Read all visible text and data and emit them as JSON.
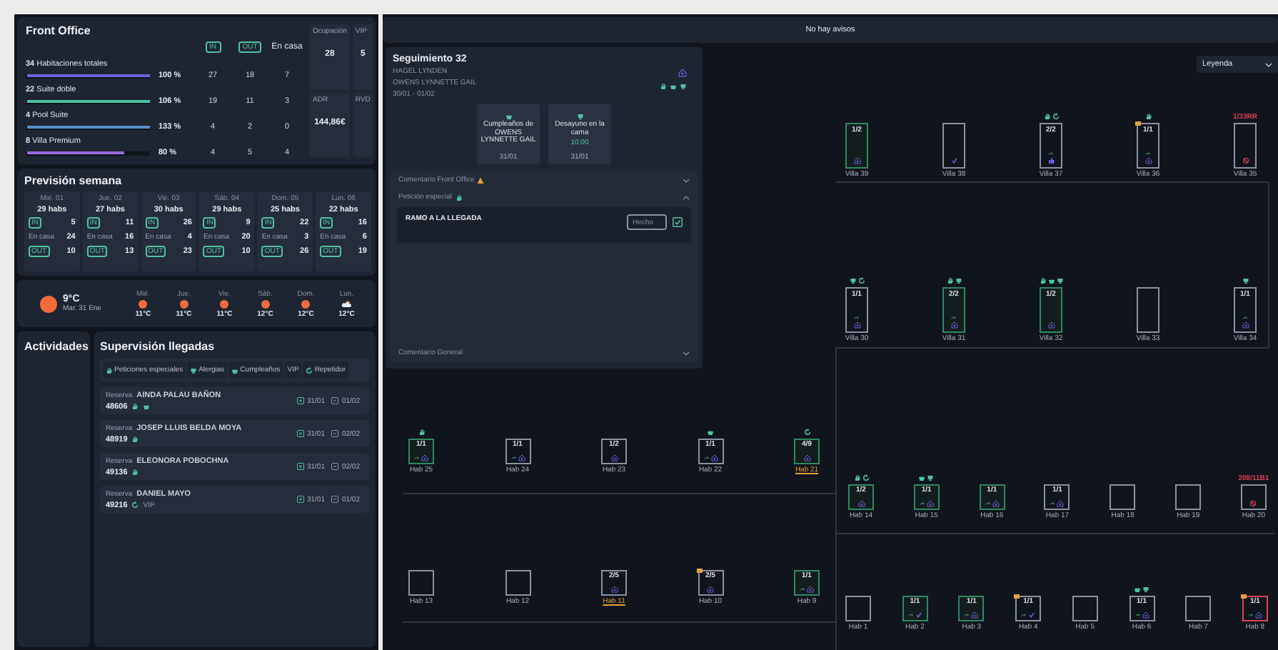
{
  "front_office": {
    "title": "Front Office",
    "columns": [
      {
        "text": "IN",
        "kind": "badge"
      },
      {
        "text": "OUT",
        "kind": "badge"
      },
      {
        "text": "En casa",
        "kind": "plain"
      }
    ],
    "rows": [
      {
        "label": "**34** Habitaciones totales",
        "level": 1,
        "color": "#6c63e0",
        "percent": "100 %",
        "values": [
          "27",
          "18",
          "7"
        ]
      },
      {
        "label": "**22** Suite doble",
        "level": 1,
        "color": "#4fc3a1",
        "percent": "106 %",
        "values": [
          "19",
          "11",
          "3"
        ]
      },
      {
        "label": "**4** Pool Suite",
        "level": 1,
        "color": "#5b8fc9",
        "percent": "133 %",
        "values": [
          "4",
          "2",
          "0"
        ]
      },
      {
        "label": "**8** Villa Premium",
        "level": 0.8,
        "color": "#9b6be0",
        "percent": "80 %",
        "values": [
          "4",
          "5",
          "4"
        ]
      }
    ],
    "stats": [
      {
        "label": "Ocupación",
        "value": "28"
      },
      {
        "label": "VIP",
        "value": "5"
      },
      {
        "label": "ADR",
        "value": "144,86€"
      },
      {
        "label": "RVD"
      }
    ]
  },
  "forecast": {
    "title": "Previsión semana",
    "days": [
      {
        "day": "Mié. 01",
        "rooms": "29 habs",
        "rows": [
          {
            "label": "IN",
            "kind": "badge",
            "value": "5"
          },
          {
            "label": "En casa",
            "kind": "plain",
            "value": "24"
          },
          {
            "label": "OUT",
            "kind": "badge",
            "value": "10"
          }
        ]
      },
      {
        "day": "Jue. 02",
        "rooms": "27 habs",
        "rows": [
          {
            "label": "IN",
            "kind": "badge",
            "value": "11"
          },
          {
            "label": "En casa",
            "kind": "plain",
            "value": "16"
          },
          {
            "label": "OUT",
            "kind": "badge",
            "value": "13"
          }
        ]
      },
      {
        "day": "Vie. 03",
        "rooms": "30 habs",
        "rows": [
          {
            "label": "IN",
            "kind": "badge",
            "value": "26"
          },
          {
            "label": "En casa",
            "kind": "plain",
            "value": "4"
          },
          {
            "label": "OUT",
            "kind": "badge",
            "value": "23"
          }
        ]
      },
      {
        "day": "Sáb. 04",
        "rooms": "29 habs",
        "rows": [
          {
            "label": "IN",
            "kind": "badge",
            "value": "9"
          },
          {
            "label": "En casa",
            "kind": "plain",
            "value": "20"
          },
          {
            "label": "OUT",
            "kind": "badge",
            "value": "10"
          }
        ]
      },
      {
        "day": "Dom. 05",
        "rooms": "25 habs",
        "rows": [
          {
            "label": "IN",
            "kind": "badge",
            "value": "22"
          },
          {
            "label": "En casa",
            "kind": "plain",
            "value": "3"
          },
          {
            "label": "OUT",
            "kind": "badge",
            "value": "26"
          }
        ]
      },
      {
        "day": "Lun. 06",
        "rooms": "22 habs",
        "rows": [
          {
            "label": "IN",
            "kind": "badge",
            "value": "16"
          },
          {
            "label": "En casa",
            "kind": "plain",
            "value": "6"
          },
          {
            "label": "OUT",
            "kind": "badge",
            "value": "19"
          }
        ]
      }
    ]
  },
  "weather": {
    "temp": "9°C",
    "date": "Mar. 31 Ene",
    "days": [
      {
        "day": "Mié.",
        "kind": "sun",
        "temp": "11°C"
      },
      {
        "day": "Jue.",
        "kind": "sun",
        "temp": "11°C"
      },
      {
        "day": "Vie.",
        "kind": "sun",
        "temp": "11°C"
      },
      {
        "day": "Sáb.",
        "kind": "sun",
        "temp": "12°C"
      },
      {
        "day": "Dom.",
        "kind": "sun",
        "temp": "12°C"
      },
      {
        "day": "Lun.",
        "kind": "cloud",
        "temp": "12°C"
      }
    ]
  },
  "activities": {
    "title": "Actividades"
  },
  "arrivals": {
    "title": "Supervisión llegadas",
    "filters": [
      {
        "kind": "request",
        "label": "Peticiones especiales"
      },
      {
        "kind": "allergy",
        "label": "Alergias"
      },
      {
        "kind": "birthday",
        "label": "Cumpleaños"
      },
      {
        "kind": "plain",
        "label": "VIP"
      },
      {
        "kind": "repeat",
        "label": "Repetidor"
      }
    ],
    "guests": [
      {
        "label": "Reserva",
        "number": "48606",
        "name": "AINDA PALAU BAÑON",
        "tags": [
          {
            "kind": "request"
          },
          {
            "kind": "birthday"
          }
        ],
        "checkin": "31/01",
        "checkout": "01/02"
      },
      {
        "label": "Reserva",
        "number": "48919",
        "name": "JOSEP LLUIS BELDA MOYA",
        "tags": [
          {
            "kind": "request"
          }
        ],
        "checkin": "31/01",
        "checkout": "02/02"
      },
      {
        "label": "Reserva",
        "number": "49136",
        "name": "ELEONORA POBOCHNA",
        "tags": [
          {
            "kind": "request"
          }
        ],
        "checkin": "31/01",
        "checkout": "02/02"
      },
      {
        "label": "Reserva",
        "number": "49216",
        "name": "DANIEL MAYO",
        "tags": [
          {
            "kind": "repeat"
          }
        ],
        "vip": "VIP",
        "checkin": "31/01",
        "checkout": "01/02"
      }
    ]
  },
  "notices": {
    "text": "No hay avisos"
  },
  "legend": {
    "label": "Leyenda"
  },
  "follow_up": {
    "title": "Seguimiento 32",
    "guests": [
      "HAGEL LYNDEN",
      "OWENS LYNNETTE GAIL"
    ],
    "dates": "30/01 - 01/02",
    "tags": [
      {
        "kind": "request"
      },
      {
        "kind": "birthday"
      },
      {
        "kind": "allergy"
      }
    ],
    "cards": [
      {
        "kind": "birthday",
        "text": "Cumpleaños de OWENS LYNNETTE GAIL",
        "date": "31/01"
      },
      {
        "kind": "allergy",
        "text": "Desayuno en la cama",
        "time": "10:00",
        "date": "31/01"
      }
    ],
    "sections": [
      {
        "title": "Comentario Front Office",
        "kind": "warning",
        "expanded": false
      },
      {
        "title": "Petición especial",
        "kind": "request",
        "expanded": true,
        "items": [
          {
            "text": "RAMO A LA LLEGADA",
            "placeholder": "Hecho",
            "checked": true
          }
        ]
      },
      {
        "title": "Comentario General",
        "kind": "plain",
        "expanded": false
      }
    ]
  },
  "room_rows": [
    {
      "kind": "villa",
      "rooms": [
        {
          "label": "Villa 39",
          "occupancy": "1/2",
          "kind": "star",
          "occupied": true,
          "blocked": false,
          "arrival": false,
          "flag": false,
          "highlight": false
        },
        {
          "label": "Villa 38",
          "kind": "check",
          "occupied": false,
          "blocked": false,
          "arrival": false,
          "flag": false,
          "highlight": false
        },
        {
          "label": "Villa 37",
          "occupancy": "2/2",
          "kind": "thumb",
          "occupied": false,
          "blocked": false,
          "tags": [
            {
              "kind": "request"
            },
            {
              "kind": "repeat"
            }
          ],
          "arrival": true,
          "flag": false,
          "highlight": false
        },
        {
          "label": "Villa 36",
          "occupancy": "1/1",
          "kind": "star",
          "occupied": false,
          "blocked": false,
          "tags": [
            {
              "kind": "request"
            }
          ],
          "arrival": true,
          "flag": true,
          "highlight": false
        },
        {
          "label": "Villa 35",
          "alert": "1/33RR",
          "kind": "prohibited",
          "occupied": false,
          "blocked": false,
          "arrival": false,
          "flag": false,
          "highlight": false
        }
      ]
    },
    {
      "kind": "villa",
      "rooms": [
        {
          "label": "Villa 30",
          "occupancy": "1/1",
          "kind": "star",
          "occupied": false,
          "blocked": false,
          "tags": [
            {
              "kind": "allergy"
            },
            {
              "kind": "repeat"
            }
          ],
          "arrival": true,
          "flag": false,
          "highlight": false
        },
        {
          "label": "Villa 31",
          "occupancy": "2/2",
          "kind": "star",
          "occupied": true,
          "blocked": false,
          "tags": [
            {
              "kind": "request"
            },
            {
              "kind": "allergy"
            }
          ],
          "arrival": true,
          "flag": false,
          "highlight": false
        },
        {
          "label": "Villa 32",
          "occupancy": "1/2",
          "kind": "star",
          "occupied": true,
          "blocked": false,
          "tags": [
            {
              "kind": "request"
            },
            {
              "kind": "birthday"
            },
            {
              "kind": "allergy"
            }
          ],
          "arrival": false,
          "flag": false,
          "highlight": false
        },
        {
          "label": "Villa 33",
          "kind": "empty",
          "occupied": false,
          "blocked": false,
          "arrival": false,
          "flag": false,
          "highlight": false
        },
        {
          "label": "Villa 34",
          "occupancy": "1/1",
          "kind": "star",
          "occupied": false,
          "blocked": false,
          "tags": [
            {
              "kind": "allergy"
            }
          ],
          "arrival": true,
          "flag": false,
          "highlight": false
        }
      ]
    },
    {
      "kind": "room",
      "rooms": [
        {
          "label": "Hab 25",
          "occupancy": "1/1",
          "kind": "star",
          "occupied": true,
          "blocked": false,
          "tags": [
            {
              "kind": "request"
            }
          ],
          "arrival": true,
          "flag": false,
          "highlight": false
        },
        {
          "label": "Hab 24",
          "occupancy": "1/1",
          "kind": "star",
          "occupied": false,
          "blocked": false,
          "arrival": true,
          "flag": false,
          "highlight": false
        },
        {
          "label": "Hab 23",
          "occupancy": "1/2",
          "kind": "star",
          "occupied": false,
          "blocked": false,
          "arrival": false,
          "flag": false,
          "highlight": false
        },
        {
          "label": "Hab 22",
          "occupancy": "1/1",
          "kind": "star",
          "occupied": false,
          "blocked": false,
          "tags": [
            {
              "kind": "birthday"
            }
          ],
          "arrival": true,
          "flag": false,
          "highlight": false
        },
        {
          "label": "Hab 21",
          "occupancy": "4/9",
          "kind": "star",
          "occupied": true,
          "blocked": false,
          "tags": [
            {
              "kind": "repeat"
            }
          ],
          "arrival": false,
          "flag": false,
          "highlight": true
        }
      ]
    },
    {
      "kind": "room",
      "rooms": [
        {
          "label": "Hab 14",
          "occupancy": "1/2",
          "kind": "star",
          "occupied": true,
          "blocked": false,
          "tags": [
            {
              "kind": "request"
            },
            {
              "kind": "repeat"
            }
          ],
          "arrival": false,
          "flag": false,
          "highlight": false
        },
        {
          "label": "Hab 15",
          "occupancy": "1/1",
          "kind": "star",
          "occupied": true,
          "blocked": false,
          "tags": [
            {
              "kind": "birthday"
            },
            {
              "kind": "allergy"
            }
          ],
          "arrival": true,
          "flag": false,
          "highlight": false
        },
        {
          "label": "Hab 16",
          "occupancy": "1/1",
          "kind": "star",
          "occupied": true,
          "blocked": false,
          "arrival": true,
          "flag": false,
          "highlight": false
        },
        {
          "label": "Hab 17",
          "occupancy": "1/1",
          "kind": "star",
          "occupied": false,
          "blocked": false,
          "arrival": true,
          "flag": false,
          "highlight": false
        },
        {
          "label": "Hab 18",
          "kind": "empty",
          "occupied": false,
          "blocked": false,
          "arrival": false,
          "flag": false,
          "highlight": false
        },
        {
          "label": "Hab 19",
          "kind": "empty",
          "occupied": false,
          "blocked": false,
          "arrival": false,
          "flag": false,
          "highlight": false
        },
        {
          "label": "Hab 20",
          "alert": "208/11B1",
          "kind": "prohibited",
          "occupied": false,
          "blocked": false,
          "arrival": false,
          "flag": false,
          "highlight": false
        }
      ]
    },
    {
      "kind": "room",
      "rooms": [
        {
          "label": "Hab 13",
          "kind": "empty",
          "occupied": false,
          "blocked": false,
          "arrival": false,
          "flag": false,
          "highlight": false
        },
        {
          "label": "Hab 12",
          "kind": "empty",
          "occupied": false,
          "blocked": false,
          "arrival": false,
          "flag": false,
          "highlight": false
        },
        {
          "label": "Hab 11",
          "occupancy": "2/5",
          "kind": "star",
          "occupied": false,
          "blocked": false,
          "arrival": false,
          "flag": false,
          "highlight": true
        },
        {
          "label": "Hab 10",
          "occupancy": "2/5",
          "kind": "star",
          "occupied": false,
          "blocked": false,
          "arrival": false,
          "flag": true,
          "highlight": false
        },
        {
          "label": "Hab 9",
          "occupancy": "1/1",
          "kind": "star",
          "occupied": true,
          "blocked": false,
          "arrival": true,
          "flag": false,
          "highlight": false
        }
      ]
    },
    {
      "kind": "room",
      "rooms": [
        {
          "label": "Hab 1",
          "kind": "empty",
          "occupied": false,
          "blocked": false,
          "arrival": false,
          "flag": false,
          "highlight": false
        },
        {
          "label": "Hab 2",
          "occupancy": "1/1",
          "kind": "check",
          "occupied": true,
          "blocked": false,
          "arrival": true,
          "flag": false,
          "highlight": false
        },
        {
          "label": "Hab 3",
          "occupancy": "1/1",
          "kind": "star",
          "occupied": true,
          "blocked": false,
          "arrival": true,
          "flag": false,
          "highlight": false
        },
        {
          "label": "Hab 4",
          "occupancy": "1/1",
          "kind": "check",
          "occupied": false,
          "blocked": false,
          "arrival": true,
          "flag": true,
          "highlight": false
        },
        {
          "label": "Hab 5",
          "kind": "empty",
          "occupied": false,
          "blocked": false,
          "arrival": false,
          "flag": false,
          "highlight": false
        },
        {
          "label": "Hab 6",
          "occupancy": "1/1",
          "kind": "star",
          "occupied": false,
          "blocked": false,
          "tags": [
            {
              "kind": "birthday"
            },
            {
              "kind": "allergy"
            }
          ],
          "arrival": true,
          "flag": false,
          "highlight": false
        },
        {
          "label": "Hab 7",
          "kind": "empty",
          "occupied": false,
          "blocked": false,
          "arrival": false,
          "flag": false,
          "highlight": false
        },
        {
          "label": "Hab 8",
          "occupancy": "1/1",
          "kind": "star",
          "occupied": false,
          "blocked": true,
          "arrival": true,
          "flag": true,
          "highlight": false
        }
      ]
    }
  ]
}
